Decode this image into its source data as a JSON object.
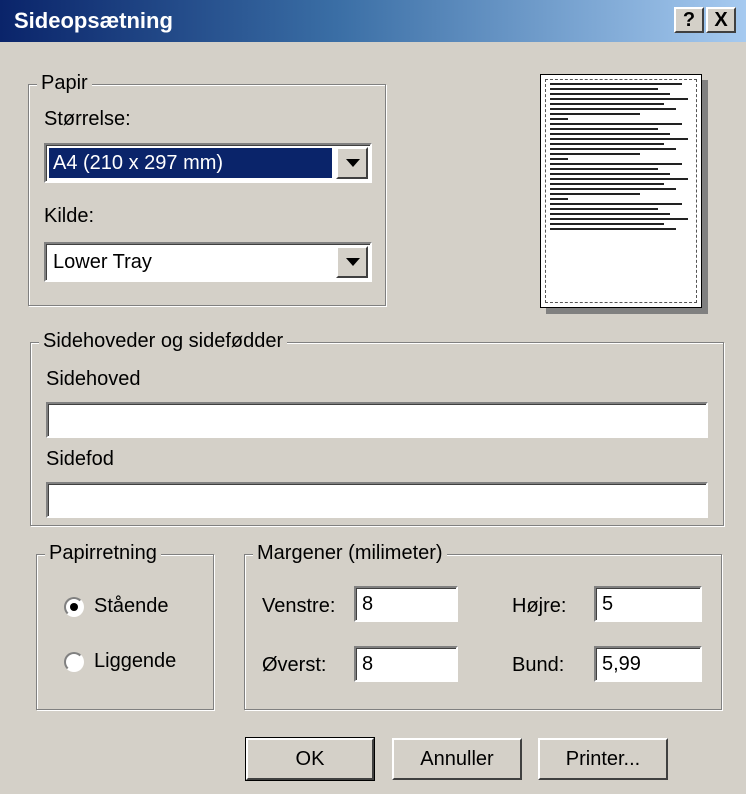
{
  "window": {
    "title": "Sideopsætning",
    "help_label": "?",
    "close_label": "X"
  },
  "paper": {
    "legend": "Papir",
    "size_label": "Størrelse:",
    "size_value": "A4 (210 x 297 mm)",
    "source_label": "Kilde:",
    "source_value": "Lower Tray"
  },
  "headers_footers": {
    "legend": "Sidehoveder og sidefødder",
    "header_label": "Sidehoved",
    "header_value": "",
    "footer_label": "Sidefod",
    "footer_value": ""
  },
  "orientation": {
    "legend": "Papirretning",
    "portrait_label": "Stående",
    "landscape_label": "Liggende",
    "selected": "portrait"
  },
  "margins": {
    "legend": "Margener (milimeter)",
    "left_label": "Venstre:",
    "left_value": "8",
    "right_label": "Højre:",
    "right_value": "5",
    "top_label": "Øverst:",
    "top_value": "8",
    "bottom_label": "Bund:",
    "bottom_value": "5,99"
  },
  "buttons": {
    "ok": "OK",
    "cancel": "Annuller",
    "printer": "Printer..."
  },
  "colors": {
    "titlebar_start": "#0a246a",
    "titlebar_end": "#a6caf0",
    "face": "#d4d0c8",
    "selection": "#0a246a"
  }
}
